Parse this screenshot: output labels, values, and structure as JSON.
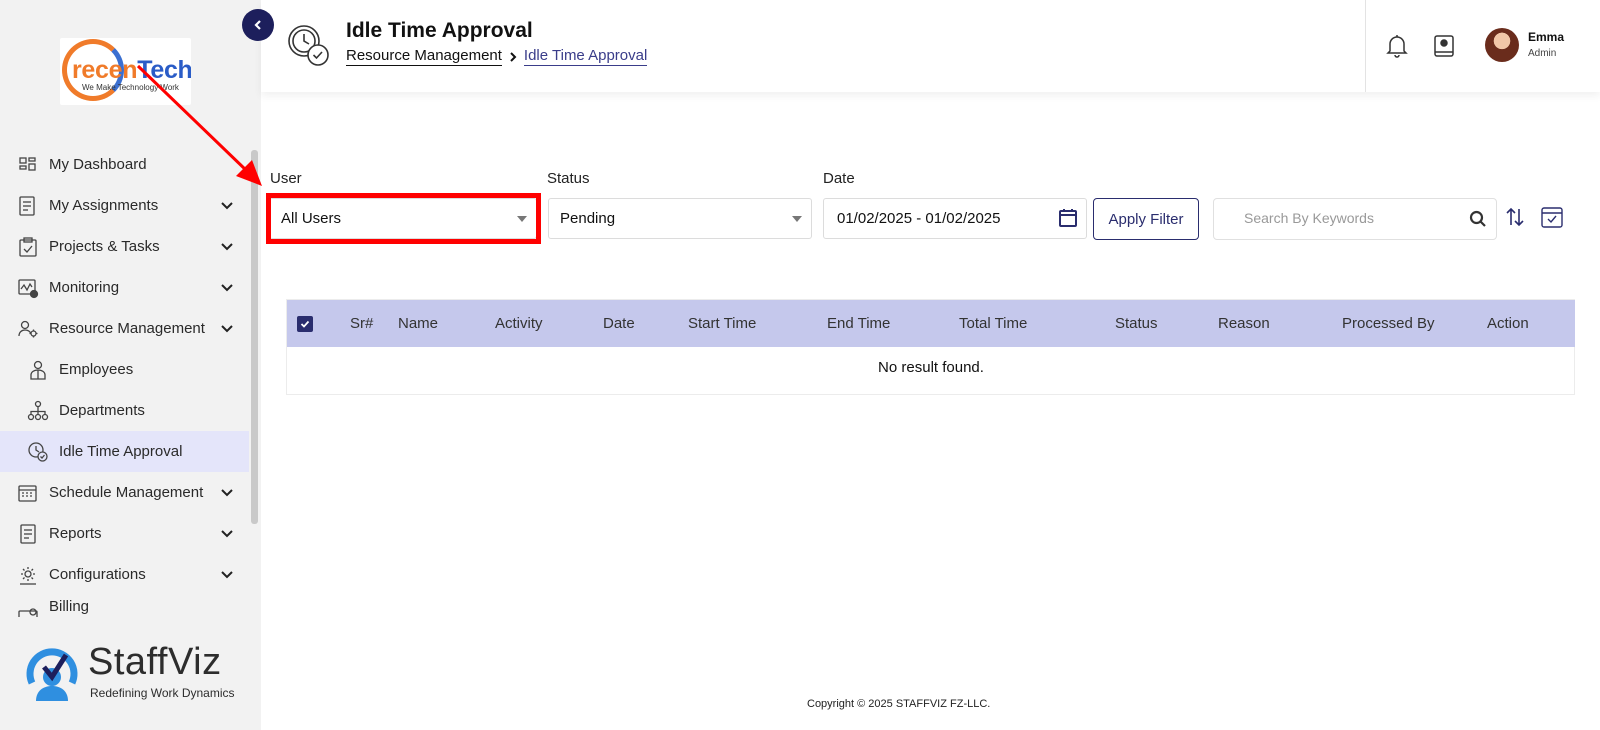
{
  "sidebar": {
    "logo": {
      "word_part1": "recen",
      "word_part2": "Tech",
      "tagline": "We Make Technology Work"
    },
    "items": [
      {
        "label": "My Dashboard",
        "icon": "dashboard-icon",
        "expandable": false
      },
      {
        "label": "My Assignments",
        "icon": "assignments-icon",
        "expandable": true
      },
      {
        "label": "Projects & Tasks",
        "icon": "clipboard-icon",
        "expandable": true
      },
      {
        "label": "Monitoring",
        "icon": "monitoring-icon",
        "expandable": true
      },
      {
        "label": "Resource Management",
        "icon": "users-gear-icon",
        "expandable": true
      },
      {
        "label": "Employees",
        "icon": "employee-icon",
        "sub": true
      },
      {
        "label": "Departments",
        "icon": "org-chart-icon",
        "sub": true
      },
      {
        "label": "Idle Time Approval",
        "icon": "clock-check-icon",
        "sub": true,
        "active": true
      },
      {
        "label": "Schedule Management",
        "icon": "calendar-icon",
        "expandable": true
      },
      {
        "label": "Reports",
        "icon": "report-icon",
        "expandable": true
      },
      {
        "label": "Configurations",
        "icon": "config-icon",
        "expandable": true
      },
      {
        "label": "Billing",
        "icon": "billing-icon",
        "expandable": false
      }
    ],
    "brand": {
      "name": "StaffViz",
      "tagline": "Redefining Work Dynamics"
    }
  },
  "header": {
    "title": "Idle Time Approval",
    "breadcrumb": [
      "Resource Management",
      "Idle Time Approval"
    ],
    "user": {
      "name": "Emma",
      "role": "Admin"
    }
  },
  "filters": {
    "user_label": "User",
    "user_value": "All Users",
    "status_label": "Status",
    "status_value": "Pending",
    "date_label": "Date",
    "date_value": "01/02/2025 - 01/02/2025",
    "apply_label": "Apply Filter",
    "search_placeholder": "Search By Keywords"
  },
  "table": {
    "columns": [
      "Sr#",
      "Name",
      "Activity",
      "Date",
      "Start Time",
      "End Time",
      "Total Time",
      "Status",
      "Reason",
      "Processed By",
      "Action"
    ],
    "empty_message": "No result found."
  },
  "footer": {
    "copyright": "Copyright © 2025 STAFFVIZ FZ-LLC."
  },
  "colors": {
    "primary": "#2a2d6e",
    "header_row": "#c5c8ec",
    "active_nav": "#e4e5fa",
    "annotation": "#ff0000"
  }
}
